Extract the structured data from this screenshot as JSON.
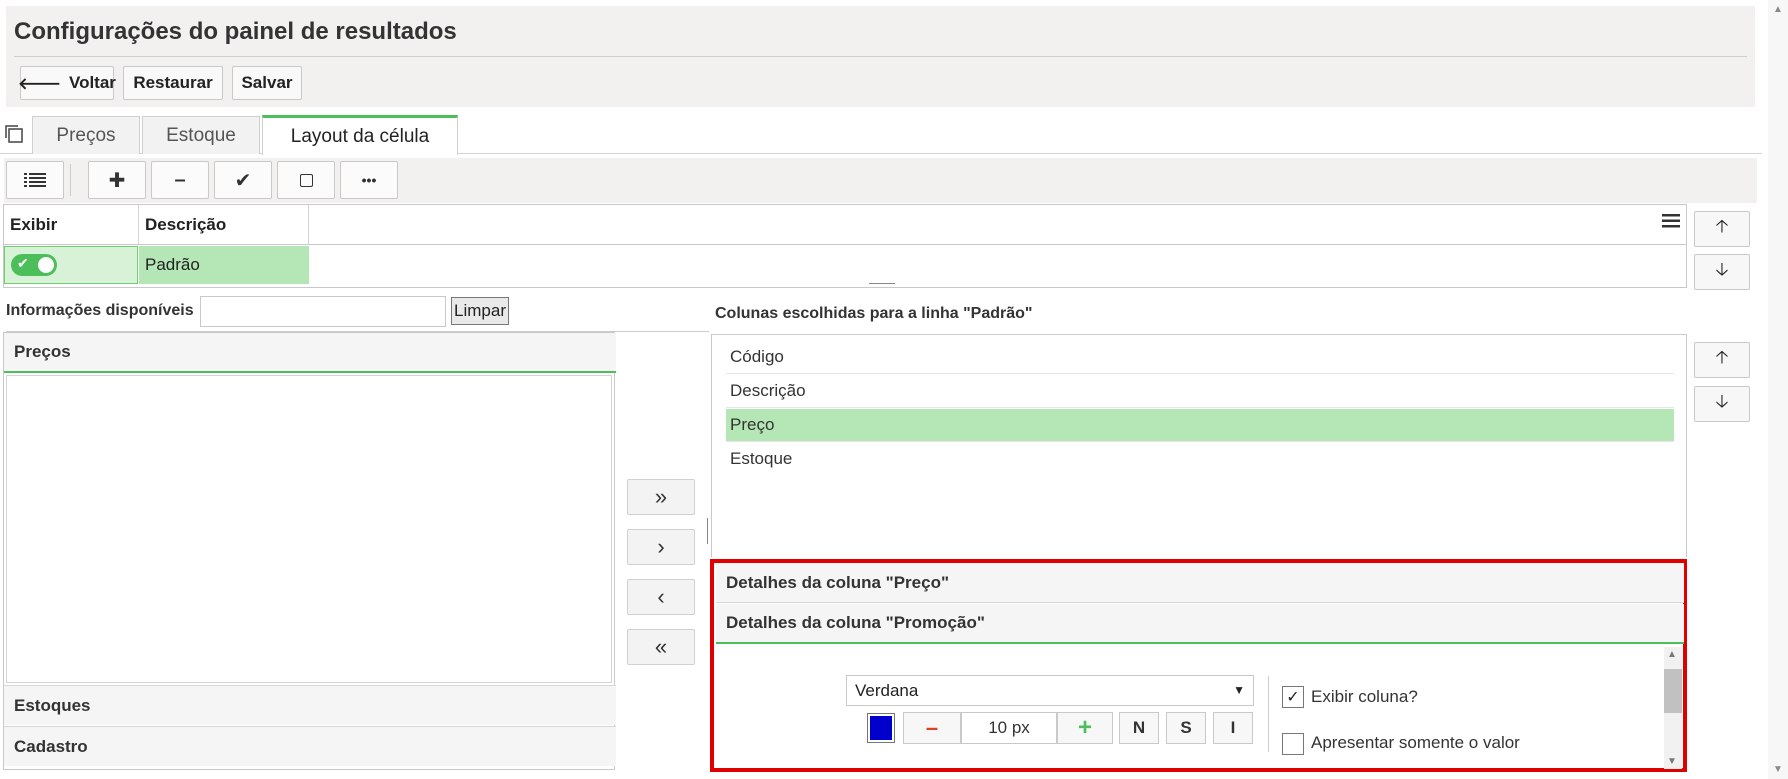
{
  "header": {
    "title": "Configurações do painel de resultados",
    "back_label": "Voltar",
    "restore_label": "Restaurar",
    "save_label": "Salvar"
  },
  "tabs": [
    {
      "label": "Preços"
    },
    {
      "label": "Estoque"
    },
    {
      "label": "Layout da célula"
    }
  ],
  "grid": {
    "col_show": "Exibir",
    "col_description": "Descrição",
    "row_value": "Padrão"
  },
  "available": {
    "label": "Informações disponíveis",
    "search_value": "",
    "clear_label": "Limpar",
    "groups": [
      "Preços",
      "Estoques",
      "Cadastro"
    ]
  },
  "chosen": {
    "label": "Colunas escolhidas para a linha \"Padrão\"",
    "items": [
      "Código",
      "Descrição",
      "Preço",
      "Estoque"
    ]
  },
  "details": {
    "price_header": "Detalhes da coluna \"Preço\"",
    "promo_header": "Detalhes da coluna \"Promoção\"",
    "font_value": "Verdana",
    "font_size": "10 px",
    "color": "#0000cc",
    "bold_label": "N",
    "underline_label": "S",
    "italic_label": "I",
    "show_column_label": "Exibir coluna?",
    "show_value_only_label": "Apresentar somente o valor"
  },
  "colors": {
    "accent": "#4cbf5a",
    "selected": "#b5e6b5",
    "highlight_border": "#e00000"
  }
}
